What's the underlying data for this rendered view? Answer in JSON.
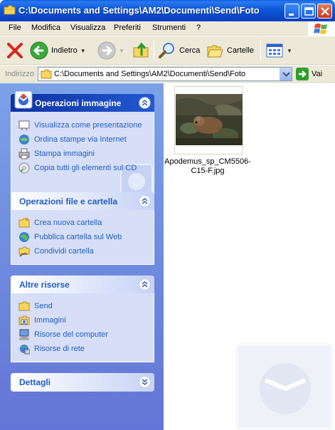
{
  "window": {
    "title": "C:\\Documents and Settings\\AM2\\Documenti\\Send\\Foto"
  },
  "menu": {
    "items": [
      "File",
      "Modifica",
      "Visualizza",
      "Preferiti",
      "Strumenti",
      "?"
    ]
  },
  "toolbar": {
    "back_label": "Indietro",
    "search_label": "Cerca",
    "folders_label": "Cartelle"
  },
  "address": {
    "label": "Indirizzo",
    "value": "C:\\Documents and Settings\\AM2\\Documenti\\Send\\Foto",
    "go_label": "Vai"
  },
  "panels": {
    "image_tasks": {
      "title": "Operazioni immagine",
      "items": [
        {
          "label": "Visualizza come presentazione",
          "icon": "slideshow-icon"
        },
        {
          "label": "Ordina stampe via Internet",
          "icon": "order-prints-icon"
        },
        {
          "label": "Stampa immagini",
          "icon": "printer-icon"
        },
        {
          "label": "Copia tutti gli elementi sul CD",
          "icon": "cd-copy-icon"
        }
      ]
    },
    "file_tasks": {
      "title": "Operazioni file e cartella",
      "items": [
        {
          "label": "Crea nuova cartella",
          "icon": "new-folder-icon"
        },
        {
          "label": "Pubblica cartella sul Web",
          "icon": "publish-web-icon"
        },
        {
          "label": "Condividi cartella",
          "icon": "share-folder-icon"
        }
      ]
    },
    "other_places": {
      "title": "Altre risorse",
      "items": [
        {
          "label": "Send",
          "icon": "folder-icon"
        },
        {
          "label": "Immagini",
          "icon": "pictures-folder-icon"
        },
        {
          "label": "Risorse del computer",
          "icon": "my-computer-icon"
        },
        {
          "label": "Risorse di rete",
          "icon": "network-places-icon"
        }
      ]
    },
    "details": {
      "title": "Dettagli"
    }
  },
  "files": [
    {
      "name": "Apodemus_sp_CM5506-C15-F.jpg"
    }
  ],
  "colors": {
    "title_bar": "#0a58d8",
    "task_pane": "#7ba2e7",
    "link": "#215dc6"
  }
}
